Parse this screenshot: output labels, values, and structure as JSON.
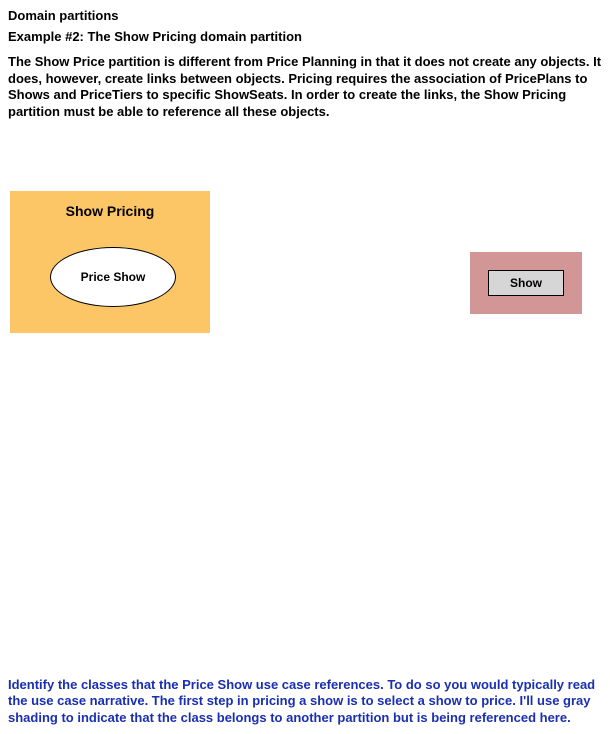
{
  "header": {
    "title": "Domain partitions",
    "subtitle": "Example #2:  The Show Pricing domain partition"
  },
  "intro": "The Show Price partition is different from Price Planning in that it does not create any objects.  It does, however, create links between objects.  Pricing requires the association of PricePlans to Shows and PriceTiers to specific ShowSeats.  In order to create the links, the Show Pricing partition must be able to reference all these objects.",
  "diagram": {
    "partition": {
      "title": "Show Pricing",
      "usecase": "Price Show"
    },
    "referenced_class": "Show"
  },
  "footer": "Identify the classes that the Price Show use case  references.  To do so you would typically read the use case narrative. The first step in pricing a show is to select a show to price.  I'll use gray shading to indicate that the class belongs to another partition but is being referenced here."
}
